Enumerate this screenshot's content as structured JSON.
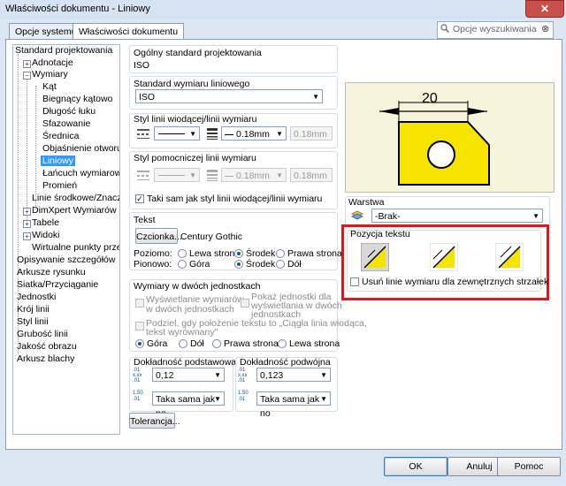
{
  "window": {
    "title": "Właściwości dokumentu - Liniowy",
    "close": "✕"
  },
  "tabs": [
    "Opcje systemu",
    "Właściwości dokumentu"
  ],
  "search": {
    "placeholder": "Opcje wyszukiwania"
  },
  "tree": {
    "items": [
      "Standard projektowania",
      "Adnotacje",
      "Wymiary",
      "Kąt",
      "Biegnący kątowo",
      "Długość łuku",
      "Sfazowanie",
      "Średnica",
      "Objaśnienie otworu",
      "Liniowy",
      "Łańcuch wymiarowy",
      "Promień",
      "Linie środkowe/Znaczniki",
      "DimXpert Wymiarów",
      "Tabele",
      "Widoki",
      "Wirtualne punkty przecięć",
      "Opisywanie szczegółów",
      "Arkusze rysunku",
      "Siatka/Przyciąganie",
      "Jednostki",
      "Krój linii",
      "Styl linii",
      "Grubość linii",
      "Jakość obrazu",
      "Arkusz blachy"
    ]
  },
  "overall_standard": {
    "label": "Ogólny standard projektowania",
    "value": "ISO"
  },
  "linear_standard": {
    "label": "Standard wymiaru liniowego",
    "value": "ISO"
  },
  "leader_style": {
    "label": "Styl linii wiodącej/linii wymiaru",
    "thickness": "0.18mm",
    "custom": "0.18mm"
  },
  "extension_style": {
    "label": "Styl pomocniczej linii wymiaru",
    "thickness": "0.18mm",
    "custom": "0.18mm",
    "same_as": "Taki sam jak styl linii wiodącej/linii wymiaru"
  },
  "text": {
    "label": "Tekst",
    "font_button": "Czcionka...",
    "font_name": "Century Gothic",
    "horizontal_label": "Poziomo:",
    "vertical_label": "Pionowo:",
    "h_options": [
      "Lewa strona",
      "Środek",
      "Prawa strona"
    ],
    "v_options": [
      "Góra",
      "Środek",
      "Dół"
    ]
  },
  "dual": {
    "label": "Wymiary w dwóch jednostkach",
    "show_dual": "Wyświetlanie wymiarów",
    "show_dual_2": "w dwóch jednostkach",
    "show_units": "Pokaż jednostki dla",
    "show_units_2": "wyświetlania w dwóch",
    "show_units_3": "jednostkach",
    "split": "Podziel, gdy położenie tekstu to „Ciągła linia wiodąca,",
    "split_2": "tekst wyrównany\"",
    "positions": [
      "Góra",
      "Dół",
      "Prawa strona",
      "Lewa strona"
    ]
  },
  "precision": {
    "primary_label": "Dokładność podstawowa",
    "primary_value": "0,12",
    "primary_tol": "Taka sama jak no",
    "dual_label": "Dokładność podwójna",
    "dual_value": "0,123",
    "dual_tol": "Taka sama jak no",
    "icon_a_top": ".01",
    "icon_a_mid": "x.xx",
    "icon_a_bot": ".01",
    "icon_b_top": "1.50",
    "icon_b_bot": ".01",
    "tolerance_button": "Tolerancja..."
  },
  "preview": {
    "dimension": "20"
  },
  "layer": {
    "label": "Warstwa",
    "value": "-Brak-"
  },
  "text_position": {
    "label": "Pozycja tekstu",
    "underline": "Usuń linie wymiaru dla zewnętrznych strzałek"
  },
  "buttons": {
    "ok": "OK",
    "cancel": "Anuluj",
    "help": "Pomoc"
  },
  "colors": {
    "accent_red": "#e0161c",
    "shape_yellow": "#f5e400",
    "selection_blue": "#3399ff"
  }
}
